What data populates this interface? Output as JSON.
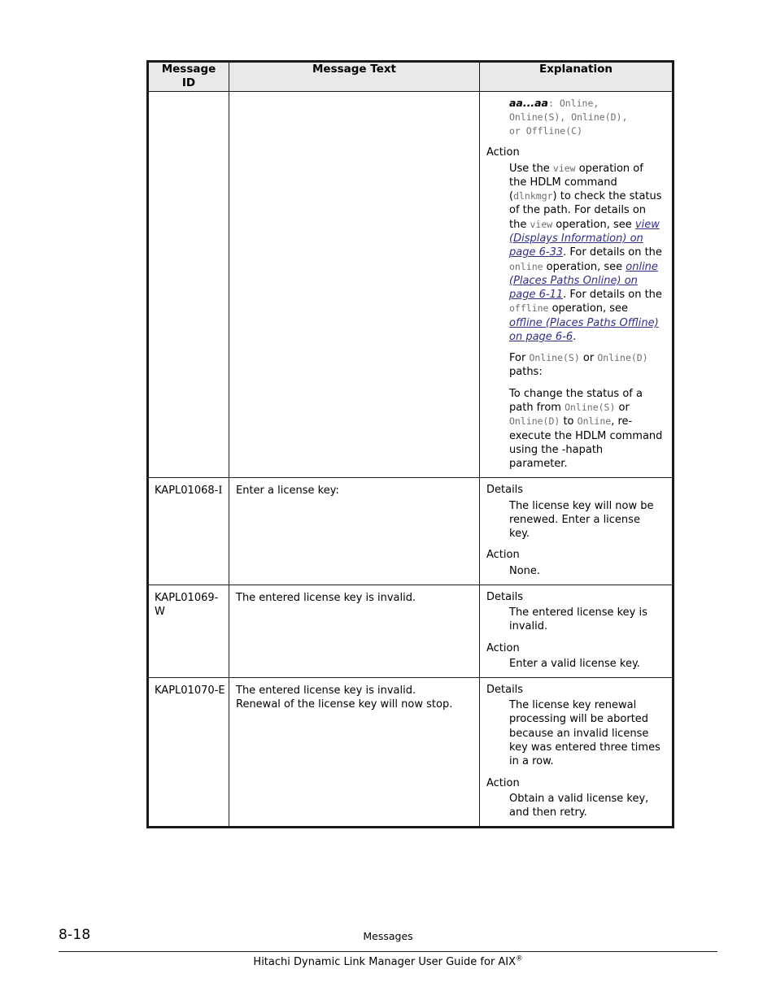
{
  "table": {
    "headers": {
      "id": "Message ID",
      "id_line1": "Message",
      "id_line2": "ID",
      "text": "Message Text",
      "explanation": "Explanation"
    },
    "rows": [
      {
        "id": "",
        "id_suffix": "",
        "message_text": "",
        "explanation": {
          "variable_note_var": "aa...aa",
          "variable_note_sep": ": ",
          "variable_note_values_line1": "Online,",
          "variable_note_values_line2": "Online(S), Online(D),",
          "variable_note_values_line3": "or Offline(C)",
          "action_label": "Action",
          "action_p1_a": "Use the ",
          "action_p1_mono1": "view",
          "action_p1_b": " operation of the HDLM command (",
          "action_p1_mono2": "dlnkmgr",
          "action_p1_c": ") to check the status of the path. For details on the ",
          "action_p1_mono3": "view",
          "action_p1_d": " operation, see ",
          "action_p1_link1": "view (Displays Information) on page 6-33",
          "action_p1_e": ". For details on the ",
          "action_p1_mono4": "online",
          "action_p1_f": " operation, see ",
          "action_p1_link2": "online (Places Paths Online) on page 6-11",
          "action_p1_g": ". For details on the ",
          "action_p1_mono5": "offline",
          "action_p1_h": " operation, see ",
          "action_p1_link3": "offline (Places Paths Offline) on page 6-6",
          "action_p1_i": ".",
          "action_p2_a": "For ",
          "action_p2_mono1": "Online(S)",
          "action_p2_b": " or ",
          "action_p2_mono2": "Online(D)",
          "action_p2_c": " paths:",
          "action_p3_a": "To change the status of a path from ",
          "action_p3_mono1": "Online(S)",
          "action_p3_b": " or ",
          "action_p3_mono2": "Online(D)",
          "action_p3_c": " to ",
          "action_p3_mono3": "Online",
          "action_p3_d": ", re-execute the HDLM command using the -hapath parameter."
        }
      },
      {
        "id": "KAPL01068-",
        "id_suffix": "I",
        "message_text": "Enter a license key:",
        "explanation": {
          "details_label": "Details",
          "details_body": "The license key will now be renewed. Enter a license key.",
          "action_label": "Action",
          "action_body": "None."
        }
      },
      {
        "id": "KAPL01069-",
        "id_suffix": "W",
        "message_text": "The entered license key is invalid.",
        "explanation": {
          "details_label": "Details",
          "details_body": "The entered license key is invalid.",
          "action_label": "Action",
          "action_body": "Enter a valid license key."
        }
      },
      {
        "id": "KAPL01070-",
        "id_suffix": "E",
        "message_text_line1": "The entered license key is invalid.",
        "message_text_line2": "Renewal of the license key will now stop.",
        "explanation": {
          "details_label": "Details",
          "details_body": "The license key renewal processing will be aborted because an invalid license key was entered three times in a row.",
          "action_label": "Action",
          "action_body": "Obtain a valid license key, and then retry."
        }
      }
    ]
  },
  "footer": {
    "page_number": "8-18",
    "chapter": "Messages",
    "book_title": "Hitachi Dynamic Link Manager User Guide for AIX",
    "book_title_mark": "®"
  }
}
